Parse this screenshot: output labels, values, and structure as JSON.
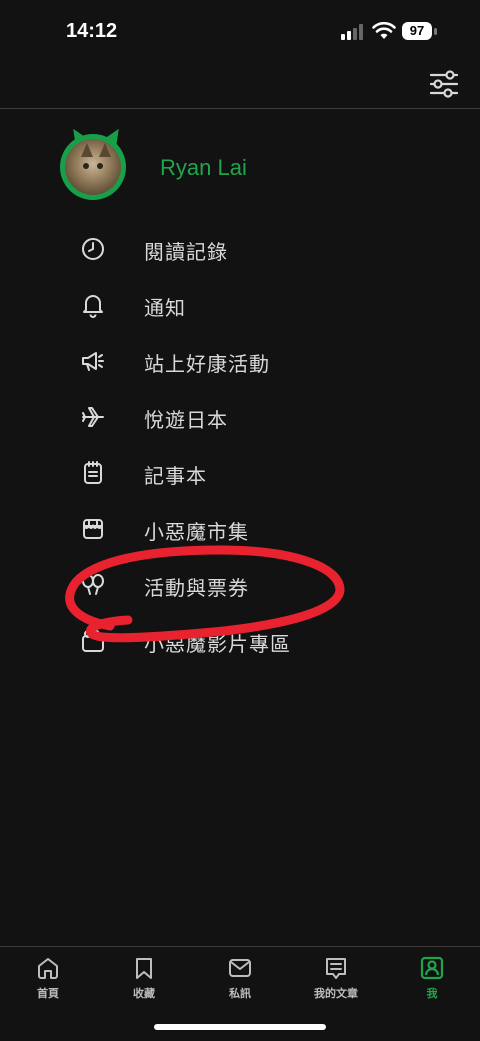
{
  "status_bar": {
    "time": "14:12",
    "battery": "97"
  },
  "profile": {
    "name": "Ryan Lai"
  },
  "menu": {
    "items": [
      {
        "label": "閱讀記錄",
        "icon": "clock-icon"
      },
      {
        "label": "通知",
        "icon": "bell-icon"
      },
      {
        "label": "站上好康活動",
        "icon": "megaphone-icon"
      },
      {
        "label": "悅遊日本",
        "icon": "airplane-icon"
      },
      {
        "label": "記事本",
        "icon": "notepad-icon"
      },
      {
        "label": "小惡魔市集",
        "icon": "storefront-icon"
      },
      {
        "label": "活動與票券",
        "icon": "balloons-icon"
      },
      {
        "label": "小惡魔影片專區",
        "icon": "video-icon"
      }
    ]
  },
  "tabbar": {
    "tabs": [
      {
        "label": "首頁",
        "icon": "home-icon",
        "active": false
      },
      {
        "label": "收藏",
        "icon": "bookmark-icon",
        "active": false
      },
      {
        "label": "私訊",
        "icon": "mail-icon",
        "active": false
      },
      {
        "label": "我的文章",
        "icon": "article-icon",
        "active": false
      },
      {
        "label": "我",
        "icon": "profile-icon",
        "active": true
      }
    ]
  },
  "colors": {
    "accent": "#1fa64c",
    "background": "#121212",
    "annotation": "#e8232f"
  }
}
